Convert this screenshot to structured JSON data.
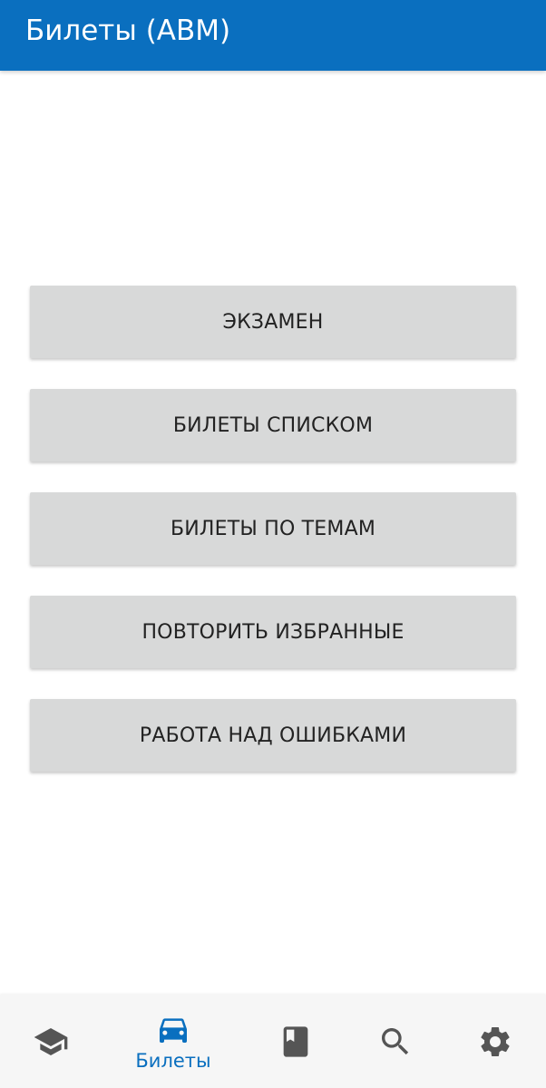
{
  "app_bar": {
    "title": "Билеты (ABM)",
    "background_color": "#0a6fbf"
  },
  "menu": {
    "buttons": [
      {
        "label": "ЭКЗАМЕН"
      },
      {
        "label": "БИЛЕТЫ СПИСКОМ"
      },
      {
        "label": "БИЛЕТЫ ПО ТЕМАМ"
      },
      {
        "label": "ПОВТОРИТЬ ИЗБРАННЫЕ"
      },
      {
        "label": "РАБОТА НАД ОШИБКАМИ"
      }
    ],
    "button_color": "#d8d9d9"
  },
  "bottom_nav": {
    "active_color": "#0a6fbf",
    "inactive_color": "#555555",
    "items": [
      {
        "icon": "graduation-cap-icon",
        "label": ""
      },
      {
        "icon": "car-icon",
        "label": "Билеты",
        "active": true
      },
      {
        "icon": "book-icon",
        "label": ""
      },
      {
        "icon": "search-icon",
        "label": ""
      },
      {
        "icon": "gear-icon",
        "label": ""
      }
    ]
  }
}
